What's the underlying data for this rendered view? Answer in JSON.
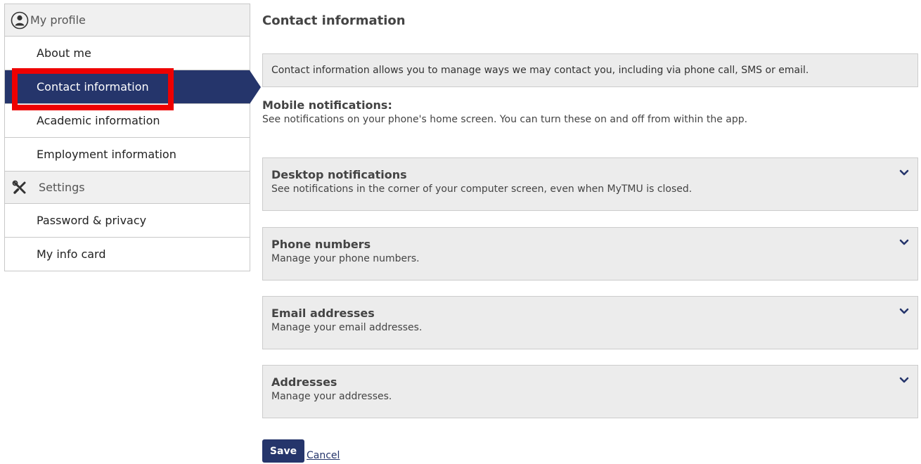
{
  "sidebar": {
    "my_profile_label": "My profile",
    "my_profile_icon": "user-circle-icon",
    "items_profile": [
      {
        "label": "About me"
      },
      {
        "label": "Contact information",
        "active": true
      },
      {
        "label": "Academic information"
      },
      {
        "label": "Employment information"
      }
    ],
    "settings_label": "Settings",
    "settings_icon": "tools-icon",
    "items_settings": [
      {
        "label": "Password & privacy"
      },
      {
        "label": "My info card"
      }
    ]
  },
  "main": {
    "title": "Contact information",
    "intro": "Contact information allows you to manage ways we may contact you, including via phone call, SMS or email.",
    "mobile": {
      "title": "Mobile notifications:",
      "description": "See notifications on your phone's home screen. You can turn these on and off from within the app."
    },
    "accordions": [
      {
        "title": "Desktop notifications",
        "description": "See notifications in the corner of your computer screen, even when MyTMU is closed."
      },
      {
        "title": "Phone numbers",
        "description": "Manage your phone numbers."
      },
      {
        "title": "Email addresses",
        "description": "Manage your email addresses."
      },
      {
        "title": "Addresses",
        "description": "Manage your addresses."
      }
    ],
    "save_label": "Save",
    "cancel_label": "Cancel"
  },
  "colors": {
    "accent": "#25356b",
    "highlight": "#ee0000",
    "panel": "#ececec"
  }
}
